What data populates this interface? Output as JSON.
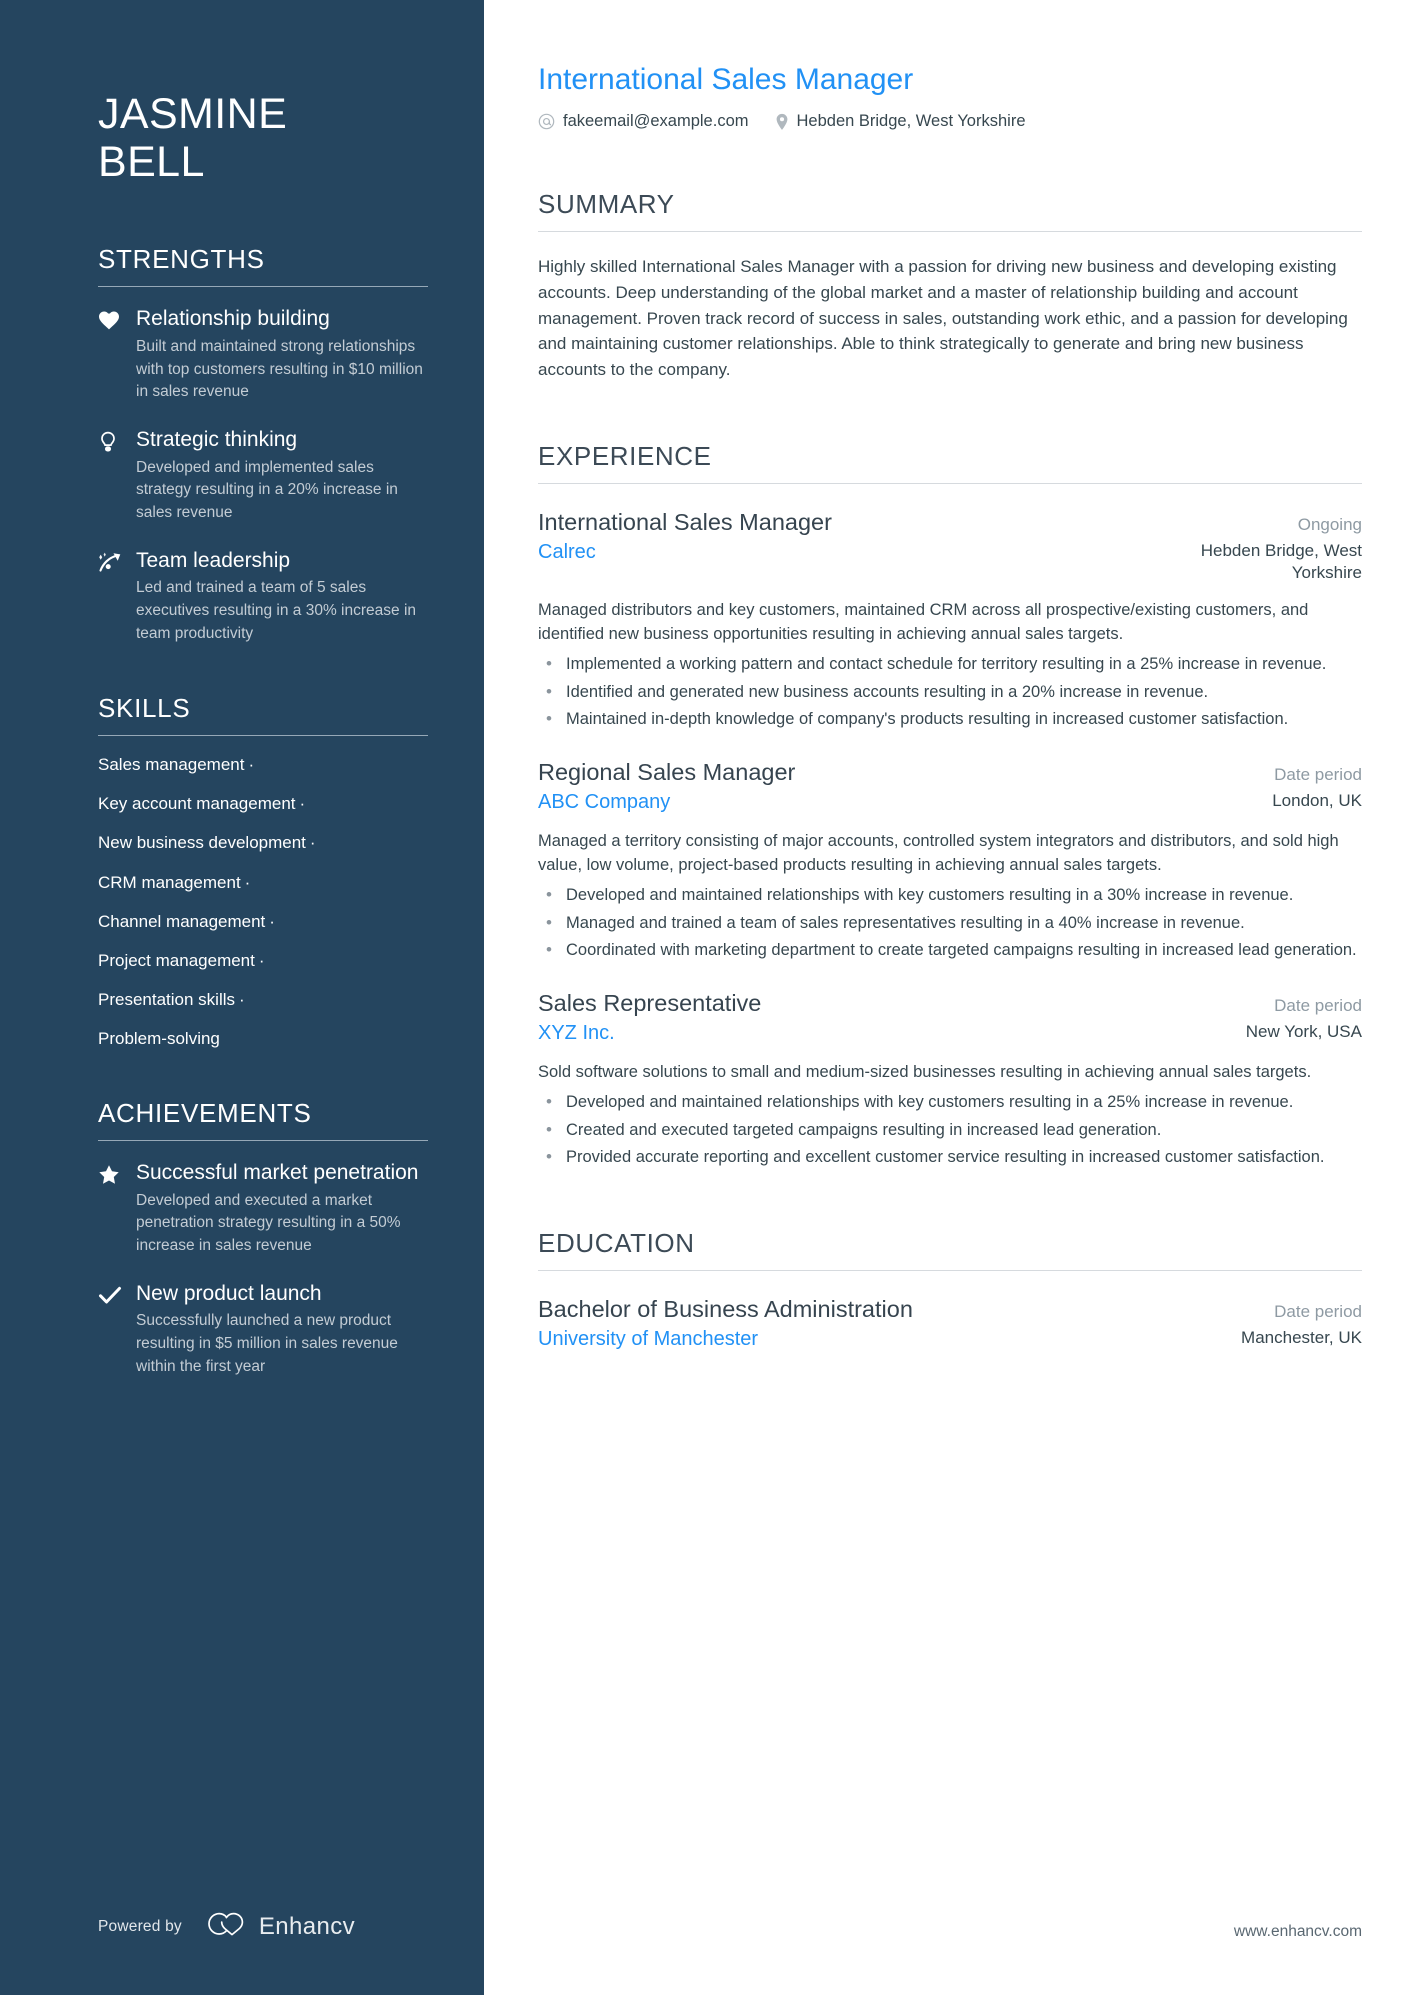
{
  "candidate": {
    "name_line1": "JASMINE",
    "name_line2": "BELL",
    "headline": "International Sales Manager",
    "email": "fakeemail@example.com",
    "location": "Hebden Bridge, West Yorkshire"
  },
  "colors": {
    "sidebar_bg": "#25455f",
    "accent_blue": "#2191f5",
    "body_text": "#37474f",
    "muted_text": "#8e9aa3",
    "sidebar_muted": "#c3ccd4"
  },
  "sidebar": {
    "strengths": {
      "heading": "STRENGTHS",
      "items": [
        {
          "icon": "heart-icon",
          "title": "Relationship building",
          "description": "Built and maintained strong relationships with top customers resulting in $10 million in sales revenue"
        },
        {
          "icon": "lightbulb-icon",
          "title": "Strategic thinking",
          "description": "Developed and implemented sales strategy resulting in a 20% increase in sales revenue"
        },
        {
          "icon": "trending-arrow-icon",
          "title": "Team leadership",
          "description": "Led and trained a team of 5 sales executives resulting in a 30% increase in team productivity"
        }
      ]
    },
    "skills": {
      "heading": "SKILLS",
      "separator": "·",
      "items": [
        "Sales management",
        "Key account management",
        "New business development",
        "CRM management",
        "Channel management",
        "Project management",
        "Presentation skills",
        "Problem-solving"
      ]
    },
    "achievements": {
      "heading": "ACHIEVEMENTS",
      "items": [
        {
          "icon": "star-icon",
          "title": "Successful market penetration",
          "description": "Developed and executed a market penetration strategy resulting in a 50% increase in sales revenue"
        },
        {
          "icon": "check-icon",
          "title": "New product launch",
          "description": "Successfully launched a new product resulting in $5 million in sales revenue within the first year"
        }
      ]
    },
    "footer": {
      "powered_by": "Powered by",
      "brand": "Enhancv",
      "brand_icon": "enhancv-logo-icon"
    }
  },
  "main": {
    "summary": {
      "heading": "SUMMARY",
      "text": "Highly skilled International Sales Manager with a passion for driving new business and developing existing accounts. Deep understanding of the global market and a master of relationship building and account management. Proven track record of success in sales, outstanding work ethic, and a passion for developing and maintaining customer relationships. Able to think strategically to generate and bring new business accounts to the company."
    },
    "experience": {
      "heading": "EXPERIENCE",
      "jobs": [
        {
          "title": "International Sales Manager",
          "date": "Ongoing",
          "company": "Calrec",
          "location": "Hebden Bridge, West Yorkshire",
          "description": "Managed distributors and key customers, maintained CRM across all prospective/existing customers, and identified new business opportunities resulting in achieving annual sales targets.",
          "bullets": [
            "Implemented a working pattern and contact schedule for territory resulting in a 25% increase in revenue.",
            "Identified and generated new business accounts resulting in a 20% increase in revenue.",
            "Maintained in-depth knowledge of company's products resulting in increased customer satisfaction."
          ]
        },
        {
          "title": "Regional Sales Manager",
          "date": "Date period",
          "company": "ABC Company",
          "location": "London, UK",
          "description": "Managed a territory consisting of major accounts, controlled system integrators and distributors, and sold high value, low volume, project-based products resulting in achieving annual sales targets.",
          "bullets": [
            "Developed and maintained relationships with key customers resulting in a 30% increase in revenue.",
            "Managed and trained a team of sales representatives resulting in a 40% increase in revenue.",
            "Coordinated with marketing department to create targeted campaigns resulting in increased lead generation."
          ]
        },
        {
          "title": "Sales Representative",
          "date": "Date period",
          "company": "XYZ Inc.",
          "location": "New York, USA",
          "description": "Sold software solutions to small and medium-sized businesses resulting in achieving annual sales targets.",
          "bullets": [
            "Developed and maintained relationships with key customers resulting in a 25% increase in revenue.",
            "Created and executed targeted campaigns resulting in increased lead generation.",
            "Provided accurate reporting and excellent customer service resulting in increased customer satisfaction."
          ]
        }
      ]
    },
    "education": {
      "heading": "EDUCATION",
      "entries": [
        {
          "degree": "Bachelor of Business Administration",
          "date": "Date period",
          "school": "University of Manchester",
          "location": "Manchester, UK"
        }
      ]
    },
    "site_url": "www.enhancv.com"
  }
}
